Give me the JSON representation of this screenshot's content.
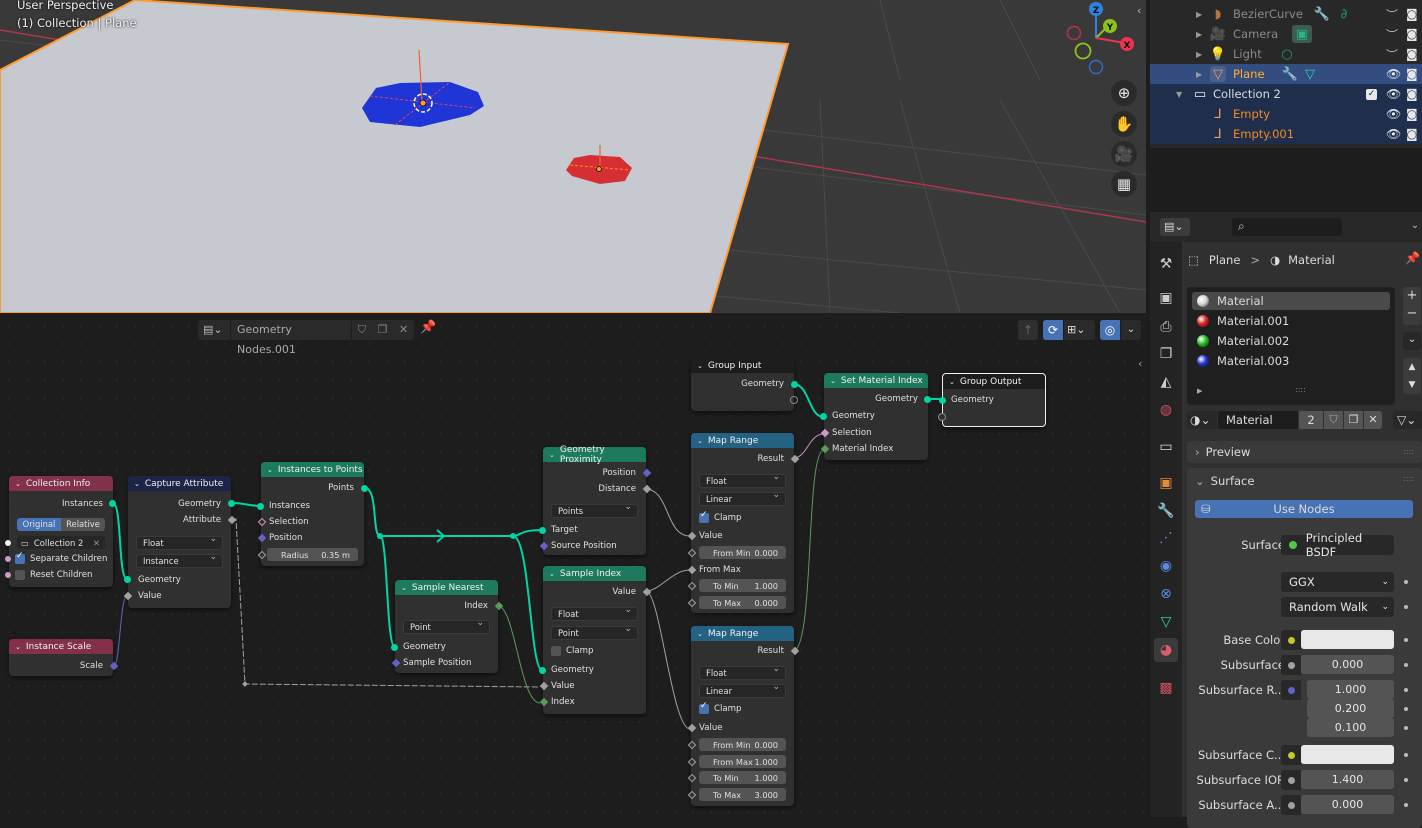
{
  "viewport": {
    "perspective_label": "User Perspective",
    "context_label": "(1) Collection | Plane",
    "gizmo": {
      "z": "Z",
      "y": "Y",
      "x": "X"
    },
    "nav_buttons": [
      "zoom-icon",
      "hand-pan-icon",
      "camera-icon",
      "grid-ortho-icon"
    ],
    "colors": {
      "plane": "#c6c9d0",
      "plane_outline": "#ff9a2e",
      "blue_mesh": "#1f35d6",
      "red_mesh": "#d62f33",
      "x_axis": "#a8384a",
      "y_axis": "#6e9a2a"
    }
  },
  "outliner": {
    "rows": [
      {
        "name": "BezierCurve",
        "type": "curve",
        "selected": false,
        "visible": false
      },
      {
        "name": "Camera",
        "type": "camera",
        "selected": false,
        "visible": false
      },
      {
        "name": "Light",
        "type": "light",
        "selected": false,
        "visible": false
      },
      {
        "name": "Plane",
        "type": "mesh",
        "selected": true,
        "visible": true
      },
      {
        "name": "Collection 2",
        "type": "collection",
        "selected": false,
        "visible": true,
        "checked": true
      },
      {
        "name": "Empty",
        "type": "empty",
        "selected": false,
        "visible": true
      },
      {
        "name": "Empty.001",
        "type": "empty",
        "selected": false,
        "visible": true
      }
    ]
  },
  "properties": {
    "search_placeholder": "",
    "breadcrumb": {
      "object": "Plane",
      "separator": ">",
      "data": "Material"
    },
    "material_slots": [
      {
        "name": "Material",
        "color": "#d8d8d8",
        "active": true
      },
      {
        "name": "Material.001",
        "color": "#e02020",
        "active": false
      },
      {
        "name": "Material.002",
        "color": "#22c022",
        "active": false
      },
      {
        "name": "Material.003",
        "color": "#2030d0",
        "active": false
      }
    ],
    "material_selector": {
      "name": "Material",
      "users": "2"
    },
    "panels": {
      "preview": "Preview",
      "surface": "Surface"
    },
    "use_nodes_label": "Use Nodes",
    "surface": {
      "label": "Surface",
      "value": "Principled BSDF"
    },
    "distribution": "GGX",
    "subsurface_method": "Random Walk",
    "fields": [
      {
        "label": "Base Color",
        "value": "",
        "socket_color": "#c7c729",
        "type": "color"
      },
      {
        "label": "Subsurface",
        "value": "0.000",
        "socket_color": "#a1a1a1",
        "type": "number"
      },
      {
        "label": "Subsurface R...",
        "values": [
          "1.000",
          "0.200",
          "0.100"
        ],
        "socket_color": "#6363c7",
        "type": "vector"
      },
      {
        "label": "Subsurface C...",
        "value": "",
        "socket_color": "#c7c729",
        "type": "color"
      },
      {
        "label": "Subsurface IOR",
        "value": "1.400",
        "socket_color": "#a1a1a1",
        "type": "slider",
        "fill": 0.04
      },
      {
        "label": "Subsurface A...",
        "value": "0.000",
        "socket_color": "#a1a1a1",
        "type": "number"
      }
    ]
  },
  "node_editor": {
    "node_group_name": "Geometry Nodes.001",
    "nodes": {
      "collection_info": {
        "title": "Collection Info",
        "out": "Instances",
        "mode_a": "Original",
        "mode_b": "Relative",
        "collection": "Collection 2",
        "separate_children": "Separate Children",
        "reset_children": "Reset Children"
      },
      "capture_attribute": {
        "title": "Capture Attribute",
        "out_geo": "Geometry",
        "out_attr": "Attribute",
        "type": "Float",
        "domain": "Instance",
        "in_geo": "Geometry",
        "in_value": "Value"
      },
      "instance_scale": {
        "title": "Instance Scale",
        "out": "Scale"
      },
      "instances_to_points": {
        "title": "Instances to Points",
        "out": "Points",
        "in1": "Instances",
        "in2": "Selection",
        "in3": "Position",
        "radius_label": "Radius",
        "radius_value": "0.35 m"
      },
      "sample_nearest": {
        "title": "Sample Nearest",
        "out": "Index",
        "domain": "Point",
        "in1": "Geometry",
        "in2": "Sample Position"
      },
      "geometry_proximity": {
        "title": "Geometry Proximity",
        "out1": "Position",
        "out2": "Distance",
        "mode": "Points",
        "in1": "Target",
        "in2": "Source Position"
      },
      "sample_index": {
        "title": "Sample Index",
        "out": "Value",
        "type": "Float",
        "domain": "Point",
        "clamp": "Clamp",
        "in1": "Geometry",
        "in2": "Value",
        "in3": "Index"
      },
      "group_input": {
        "title": "Group Input",
        "out": "Geometry"
      },
      "set_material_index": {
        "title": "Set Material Index",
        "out": "Geometry",
        "in1": "Geometry",
        "in2": "Selection",
        "in3": "Material Index"
      },
      "group_output": {
        "title": "Group Output",
        "in": "Geometry"
      },
      "map_range_1": {
        "title": "Map Range",
        "out": "Result",
        "type": "Float",
        "interp": "Linear",
        "clamp": "Clamp",
        "value": "Value",
        "from_min": [
          "From Min",
          "0.000"
        ],
        "from_max": "From Max",
        "to_min": [
          "To Min",
          "1.000"
        ],
        "to_max": [
          "To Max",
          "0.000"
        ]
      },
      "map_range_2": {
        "title": "Map Range",
        "out": "Result",
        "type": "Float",
        "interp": "Linear",
        "clamp": "Clamp",
        "value": "Value",
        "from_min": [
          "From Min",
          "0.000"
        ],
        "from_max": [
          "From Max",
          "1.000"
        ],
        "to_min": [
          "To Min",
          "1.000"
        ],
        "to_max": [
          "To Max",
          "3.000"
        ]
      }
    },
    "colors": {
      "input_header": "#83314a",
      "attr_header": "#1d2546",
      "geo_header": "#1e7a5e",
      "converter_header": "#246283",
      "group_header": "#1d1d1d",
      "geo_link": "#00d6a3",
      "float_link": "#a1a1a1"
    }
  }
}
